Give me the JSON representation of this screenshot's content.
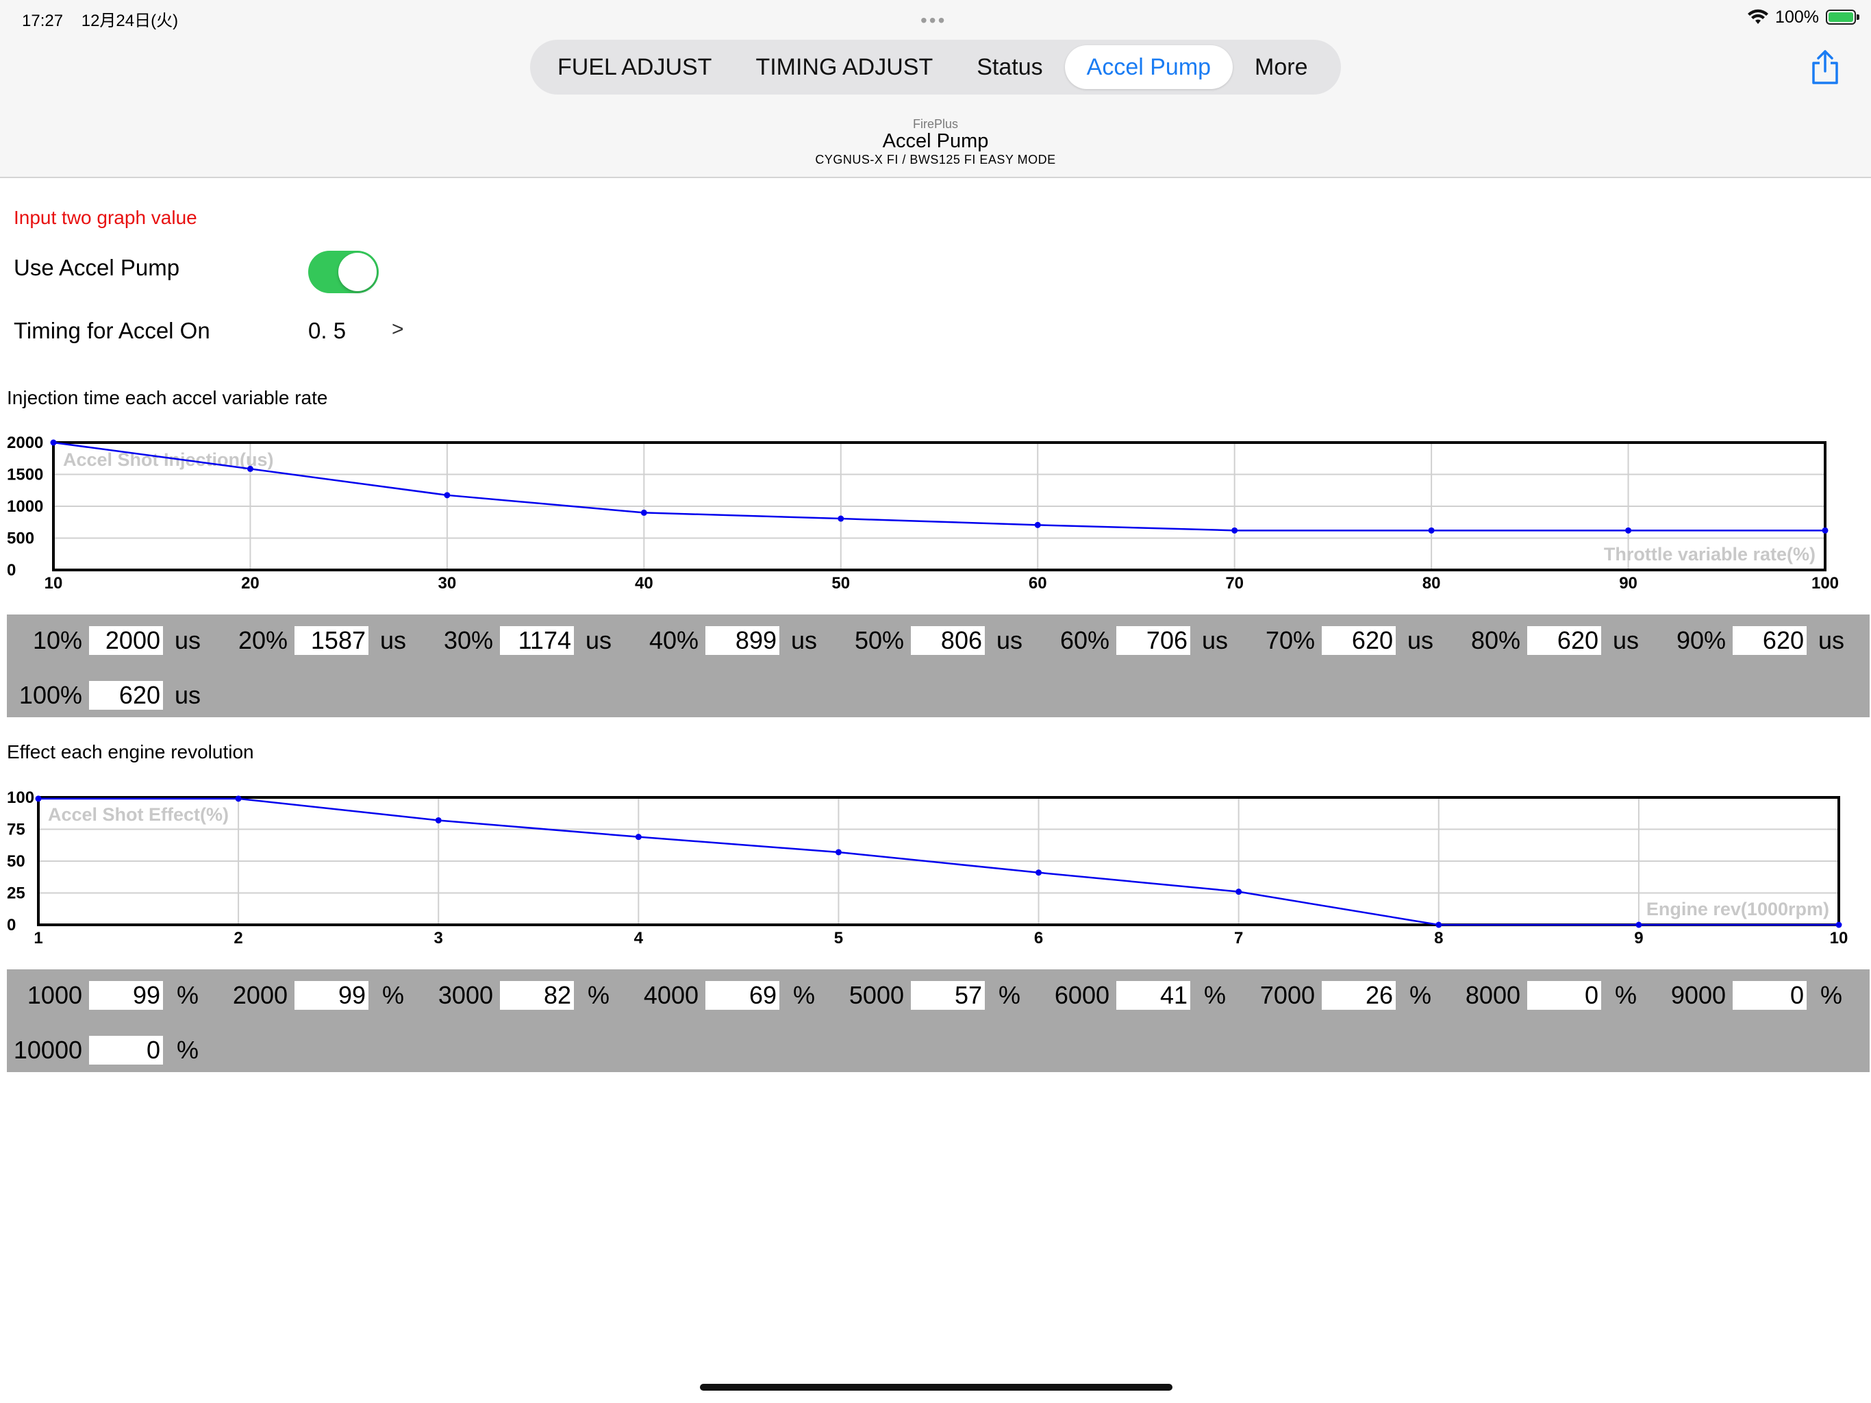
{
  "status_bar": {
    "time": "17:27",
    "date": "12月24日(火)",
    "more_dots": "•••",
    "battery_text": "100%",
    "battery_level": 1.0
  },
  "tabs": [
    {
      "label": "FUEL ADJUST",
      "active": false
    },
    {
      "label": "TIMING ADJUST",
      "active": false
    },
    {
      "label": "Status",
      "active": false
    },
    {
      "label": "Accel Pump",
      "active": true
    },
    {
      "label": "More",
      "active": false
    }
  ],
  "header": {
    "app": "FirePlus",
    "title": "Accel Pump",
    "subtitle": "CYGNUS-X FI / BWS125 FI EASY MODE"
  },
  "settings": {
    "warning": "Input two graph value",
    "use_accel_label": "Use Accel Pump",
    "use_accel_on": true,
    "timing_label": "Timing for Accel On",
    "timing_value": "0. 5",
    "timing_chevron": ">"
  },
  "colors": {
    "accent": "#1a7cf3",
    "toggle_on": "#34c759",
    "warning": "#e81010",
    "series": "#0000ee",
    "panel": "#a8a8a8"
  },
  "chart_data": [
    {
      "type": "line",
      "section_title": "Injection time each accel variable rate",
      "series_label": "Accel Shot Injection(us)",
      "axis_label": "Throttle variable rate(%)",
      "x": [
        10,
        20,
        30,
        40,
        50,
        60,
        70,
        80,
        90,
        100
      ],
      "values": [
        2000,
        1587,
        1174,
        899,
        806,
        706,
        620,
        620,
        620,
        620
      ],
      "xlim": [
        10,
        100
      ],
      "ylim": [
        0,
        2000
      ],
      "yticks": [
        0,
        500,
        1000,
        1500,
        2000
      ],
      "xticks": [
        10,
        20,
        30,
        40,
        50,
        60,
        70,
        80,
        90,
        100
      ],
      "grid": true
    },
    {
      "type": "line",
      "section_title": "Effect each engine revolution",
      "series_label": "Accel Shot Effect(%)",
      "axis_label": "Engine rev(1000rpm)",
      "x": [
        1,
        2,
        3,
        4,
        5,
        6,
        7,
        8,
        9,
        10
      ],
      "values": [
        99,
        99,
        82,
        69,
        57,
        41,
        26,
        0,
        0,
        0
      ],
      "xlim": [
        1,
        10
      ],
      "ylim": [
        0,
        100
      ],
      "yticks": [
        0,
        25,
        50,
        75,
        100
      ],
      "xticks": [
        1,
        2,
        3,
        4,
        5,
        6,
        7,
        8,
        9,
        10
      ],
      "grid": true
    }
  ],
  "injection_table": {
    "unit": "us",
    "rows": [
      {
        "label": "10%",
        "value": "2000"
      },
      {
        "label": "20%",
        "value": "1587"
      },
      {
        "label": "30%",
        "value": "1174"
      },
      {
        "label": "40%",
        "value": "899"
      },
      {
        "label": "50%",
        "value": "806"
      },
      {
        "label": "60%",
        "value": "706"
      },
      {
        "label": "70%",
        "value": "620"
      },
      {
        "label": "80%",
        "value": "620"
      },
      {
        "label": "90%",
        "value": "620"
      },
      {
        "label": "100%",
        "value": "620"
      }
    ]
  },
  "effect_table": {
    "unit": "%",
    "rows": [
      {
        "label": "1000",
        "value": "99"
      },
      {
        "label": "2000",
        "value": "99"
      },
      {
        "label": "3000",
        "value": "82"
      },
      {
        "label": "4000",
        "value": "69"
      },
      {
        "label": "5000",
        "value": "57"
      },
      {
        "label": "6000",
        "value": "41"
      },
      {
        "label": "7000",
        "value": "26"
      },
      {
        "label": "8000",
        "value": "0"
      },
      {
        "label": "9000",
        "value": "0"
      },
      {
        "label": "10000",
        "value": "0"
      }
    ]
  }
}
